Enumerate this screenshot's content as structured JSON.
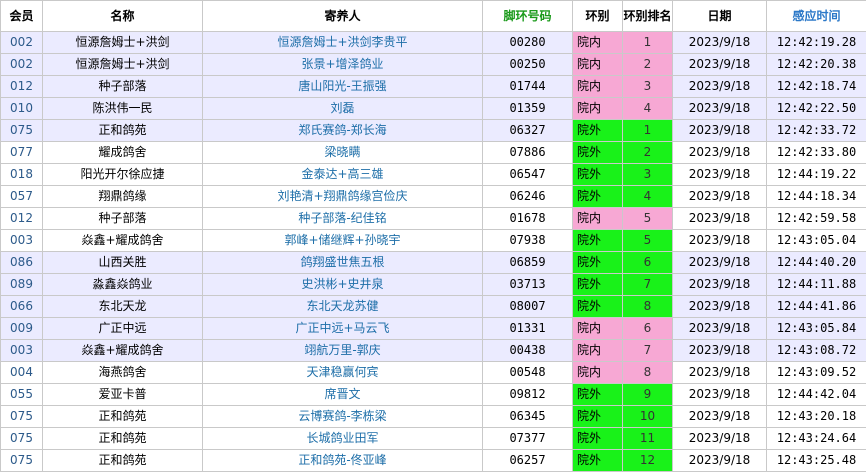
{
  "headers": {
    "member": "会员",
    "name": "名称",
    "breeder": "寄养人",
    "ring": "脚环号码",
    "zone": "环别",
    "rank": "环别排名",
    "date": "日期",
    "time": "感应时间"
  },
  "colors": {
    "inner": "#f7a8d4",
    "outer": "#19f219",
    "highlight_row": "#ebebff"
  },
  "rows": [
    {
      "member": "002",
      "name": "恒源詹姆士+洪剑",
      "breeder": "恒源詹姆士+洪剑李贵平",
      "ring": "00280",
      "zone": "院内",
      "rank": "1",
      "date": "2023/9/18",
      "time": "12:42:19.28"
    },
    {
      "member": "002",
      "name": "恒源詹姆士+洪剑",
      "breeder": "张景+增泽鸽业",
      "ring": "00250",
      "zone": "院内",
      "rank": "2",
      "date": "2023/9/18",
      "time": "12:42:20.38"
    },
    {
      "member": "012",
      "name": "种子部落",
      "breeder": "唐山阳光-王振强",
      "ring": "01744",
      "zone": "院内",
      "rank": "3",
      "date": "2023/9/18",
      "time": "12:42:18.74"
    },
    {
      "member": "010",
      "name": "陈洪伟一民",
      "breeder": "刘磊",
      "ring": "01359",
      "zone": "院内",
      "rank": "4",
      "date": "2023/9/18",
      "time": "12:42:22.50"
    },
    {
      "member": "075",
      "name": "正和鸽苑",
      "breeder": "郑氏赛鸽-郑长海",
      "ring": "06327",
      "zone": "院外",
      "rank": "1",
      "date": "2023/9/18",
      "time": "12:42:33.72"
    },
    {
      "member": "077",
      "name": "耀成鸽舍",
      "breeder": "梁晓瞒",
      "ring": "07886",
      "zone": "院外",
      "rank": "2",
      "date": "2023/9/18",
      "time": "12:42:33.80"
    },
    {
      "member": "018",
      "name": "阳光开尔徐应捷",
      "breeder": "金泰达+高三雄",
      "ring": "06547",
      "zone": "院外",
      "rank": "3",
      "date": "2023/9/18",
      "time": "12:44:19.22"
    },
    {
      "member": "057",
      "name": "翔鼎鸽缘",
      "breeder": "刘艳清+翔鼎鸽缘宫俭庆",
      "ring": "06246",
      "zone": "院外",
      "rank": "4",
      "date": "2023/9/18",
      "time": "12:44:18.34"
    },
    {
      "member": "012",
      "name": "种子部落",
      "breeder": "种子部落-纪佳铭",
      "ring": "01678",
      "zone": "院内",
      "rank": "5",
      "date": "2023/9/18",
      "time": "12:42:59.58"
    },
    {
      "member": "003",
      "name": "焱鑫+耀成鸽舍",
      "breeder": "郭峰+储继辉+孙晓宇",
      "ring": "07938",
      "zone": "院外",
      "rank": "5",
      "date": "2023/9/18",
      "time": "12:43:05.04"
    },
    {
      "member": "086",
      "name": "山西关胜",
      "breeder": "鸽翔盛世焦五根",
      "ring": "06859",
      "zone": "院外",
      "rank": "6",
      "date": "2023/9/18",
      "time": "12:44:40.20"
    },
    {
      "member": "089",
      "name": "淼鑫焱鸽业",
      "breeder": "史洪彬+史井泉",
      "ring": "03713",
      "zone": "院外",
      "rank": "7",
      "date": "2023/9/18",
      "time": "12:44:11.88"
    },
    {
      "member": "066",
      "name": "东北天龙",
      "breeder": "东北天龙苏健",
      "ring": "08007",
      "zone": "院外",
      "rank": "8",
      "date": "2023/9/18",
      "time": "12:44:41.86"
    },
    {
      "member": "009",
      "name": "广正中远",
      "breeder": "广正中远+马云飞",
      "ring": "01331",
      "zone": "院内",
      "rank": "6",
      "date": "2023/9/18",
      "time": "12:43:05.84"
    },
    {
      "member": "003",
      "name": "焱鑫+耀成鸽舍",
      "breeder": "翊航万里-郭庆",
      "ring": "00438",
      "zone": "院内",
      "rank": "7",
      "date": "2023/9/18",
      "time": "12:43:08.72"
    },
    {
      "member": "004",
      "name": "海燕鸽舍",
      "breeder": "天津稳赢何宾",
      "ring": "00548",
      "zone": "院内",
      "rank": "8",
      "date": "2023/9/18",
      "time": "12:43:09.52"
    },
    {
      "member": "055",
      "name": "爱亚卡普",
      "breeder": "席晋文",
      "ring": "09812",
      "zone": "院外",
      "rank": "9",
      "date": "2023/9/18",
      "time": "12:44:42.04"
    },
    {
      "member": "075",
      "name": "正和鸽苑",
      "breeder": "云博赛鸽-李栋梁",
      "ring": "06345",
      "zone": "院外",
      "rank": "10",
      "date": "2023/9/18",
      "time": "12:43:20.18"
    },
    {
      "member": "075",
      "name": "正和鸽苑",
      "breeder": "长城鸽业田军",
      "ring": "07377",
      "zone": "院外",
      "rank": "11",
      "date": "2023/9/18",
      "time": "12:43:24.64"
    },
    {
      "member": "075",
      "name": "正和鸽苑",
      "breeder": "正和鸽苑-佟亚峰",
      "ring": "06257",
      "zone": "院外",
      "rank": "12",
      "date": "2023/9/18",
      "time": "12:43:25.48"
    }
  ]
}
